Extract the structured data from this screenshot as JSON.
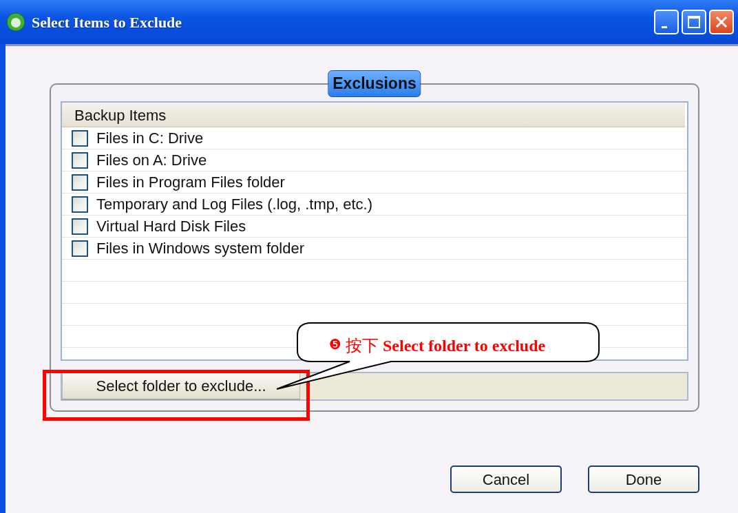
{
  "window": {
    "title": "Select Items to Exclude"
  },
  "group": {
    "legend": "Exclusions"
  },
  "list": {
    "header": "Backup Items",
    "items": [
      {
        "label": "Files in C: Drive",
        "checked": false
      },
      {
        "label": "Files on A: Drive",
        "checked": false
      },
      {
        "label": "Files in Program Files folder",
        "checked": false
      },
      {
        "label": "Temporary and Log Files (.log, .tmp, etc.)",
        "checked": false
      },
      {
        "label": "Virtual Hard Disk Files",
        "checked": false
      },
      {
        "label": "Files in Windows system folder",
        "checked": false
      }
    ]
  },
  "select_button": "Select folder to exclude...",
  "annotation": {
    "marker": "❺",
    "text": "按下 **Select folder to exclude**"
  },
  "buttons": [
    "Cancel",
    "Done"
  ]
}
